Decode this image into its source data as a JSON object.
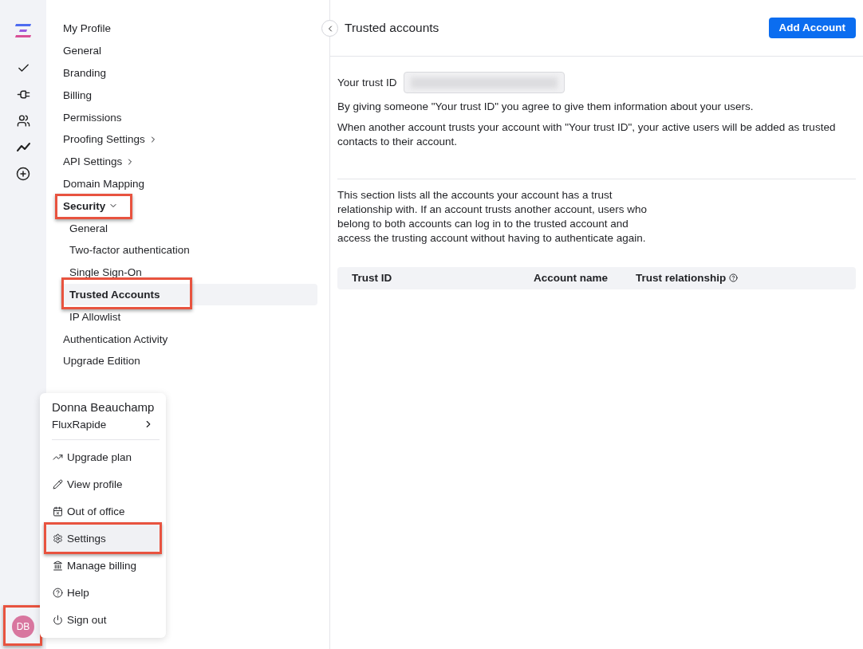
{
  "rail": {
    "avatar": {
      "initials": "DB",
      "highlighted": true
    }
  },
  "settings_nav": {
    "items": [
      {
        "label": "My Profile",
        "kind": "link",
        "selected": false,
        "highlighted": false
      },
      {
        "label": "General",
        "kind": "link",
        "selected": false,
        "highlighted": false
      },
      {
        "label": "Branding",
        "kind": "link",
        "selected": false,
        "highlighted": false
      },
      {
        "label": "Billing",
        "kind": "link",
        "selected": false,
        "highlighted": false
      },
      {
        "label": "Permissions",
        "kind": "link",
        "selected": false,
        "highlighted": false
      },
      {
        "label": "Proofing Settings",
        "kind": "submenu",
        "selected": false,
        "highlighted": false
      },
      {
        "label": "API Settings",
        "kind": "submenu",
        "selected": false,
        "highlighted": false
      },
      {
        "label": "Domain Mapping",
        "kind": "link",
        "selected": false,
        "highlighted": false
      },
      {
        "label": "Security",
        "kind": "group",
        "expanded": true,
        "selected": false,
        "highlighted": true,
        "children": [
          {
            "label": "General",
            "kind": "link",
            "selected": false,
            "highlighted": false
          },
          {
            "label": "Two-factor authentication",
            "kind": "link",
            "selected": false,
            "highlighted": false
          },
          {
            "label": "Single Sign-On",
            "kind": "link",
            "selected": false,
            "highlighted": false
          },
          {
            "label": "Trusted Accounts",
            "kind": "link",
            "selected": true,
            "highlighted": true
          },
          {
            "label": "IP Allowlist",
            "kind": "link",
            "selected": false,
            "highlighted": false
          }
        ]
      },
      {
        "label": "Authentication Activity",
        "kind": "link",
        "selected": false,
        "highlighted": false
      },
      {
        "label": "Upgrade Edition",
        "kind": "link",
        "selected": false,
        "highlighted": false
      }
    ]
  },
  "page": {
    "title": "Trusted accounts",
    "add_button": "Add Account",
    "trust_id": {
      "label": "Your trust ID",
      "value_redacted": true
    },
    "notes": [
      "By giving someone \"Your trust ID\" you agree to give them information about your users.",
      "When another account trusts your account with \"Your trust ID\", your active users will be added as trusted contacts to their account."
    ],
    "description": "This section lists all the accounts your account has a trust relationship with. If an account trusts another account, users who belong to both accounts can log in to the trusted account and access the trusting account without having to authenticate again.",
    "table": {
      "columns": [
        {
          "label": "Trust ID",
          "info": false
        },
        {
          "label": "Account name",
          "info": false
        },
        {
          "label": "Trust relationship",
          "info": true
        }
      ]
    }
  },
  "user_menu": {
    "name": "Donna Beauchamp",
    "account": "FluxRapide",
    "items": [
      {
        "label": "Upgrade plan",
        "highlighted": false
      },
      {
        "label": "View profile",
        "highlighted": false
      },
      {
        "label": "Out of office",
        "highlighted": false
      },
      {
        "label": "Settings",
        "highlighted": true
      },
      {
        "label": "Manage billing",
        "highlighted": false
      },
      {
        "label": "Help",
        "highlighted": false
      },
      {
        "label": "Sign out",
        "highlighted": false
      }
    ]
  }
}
